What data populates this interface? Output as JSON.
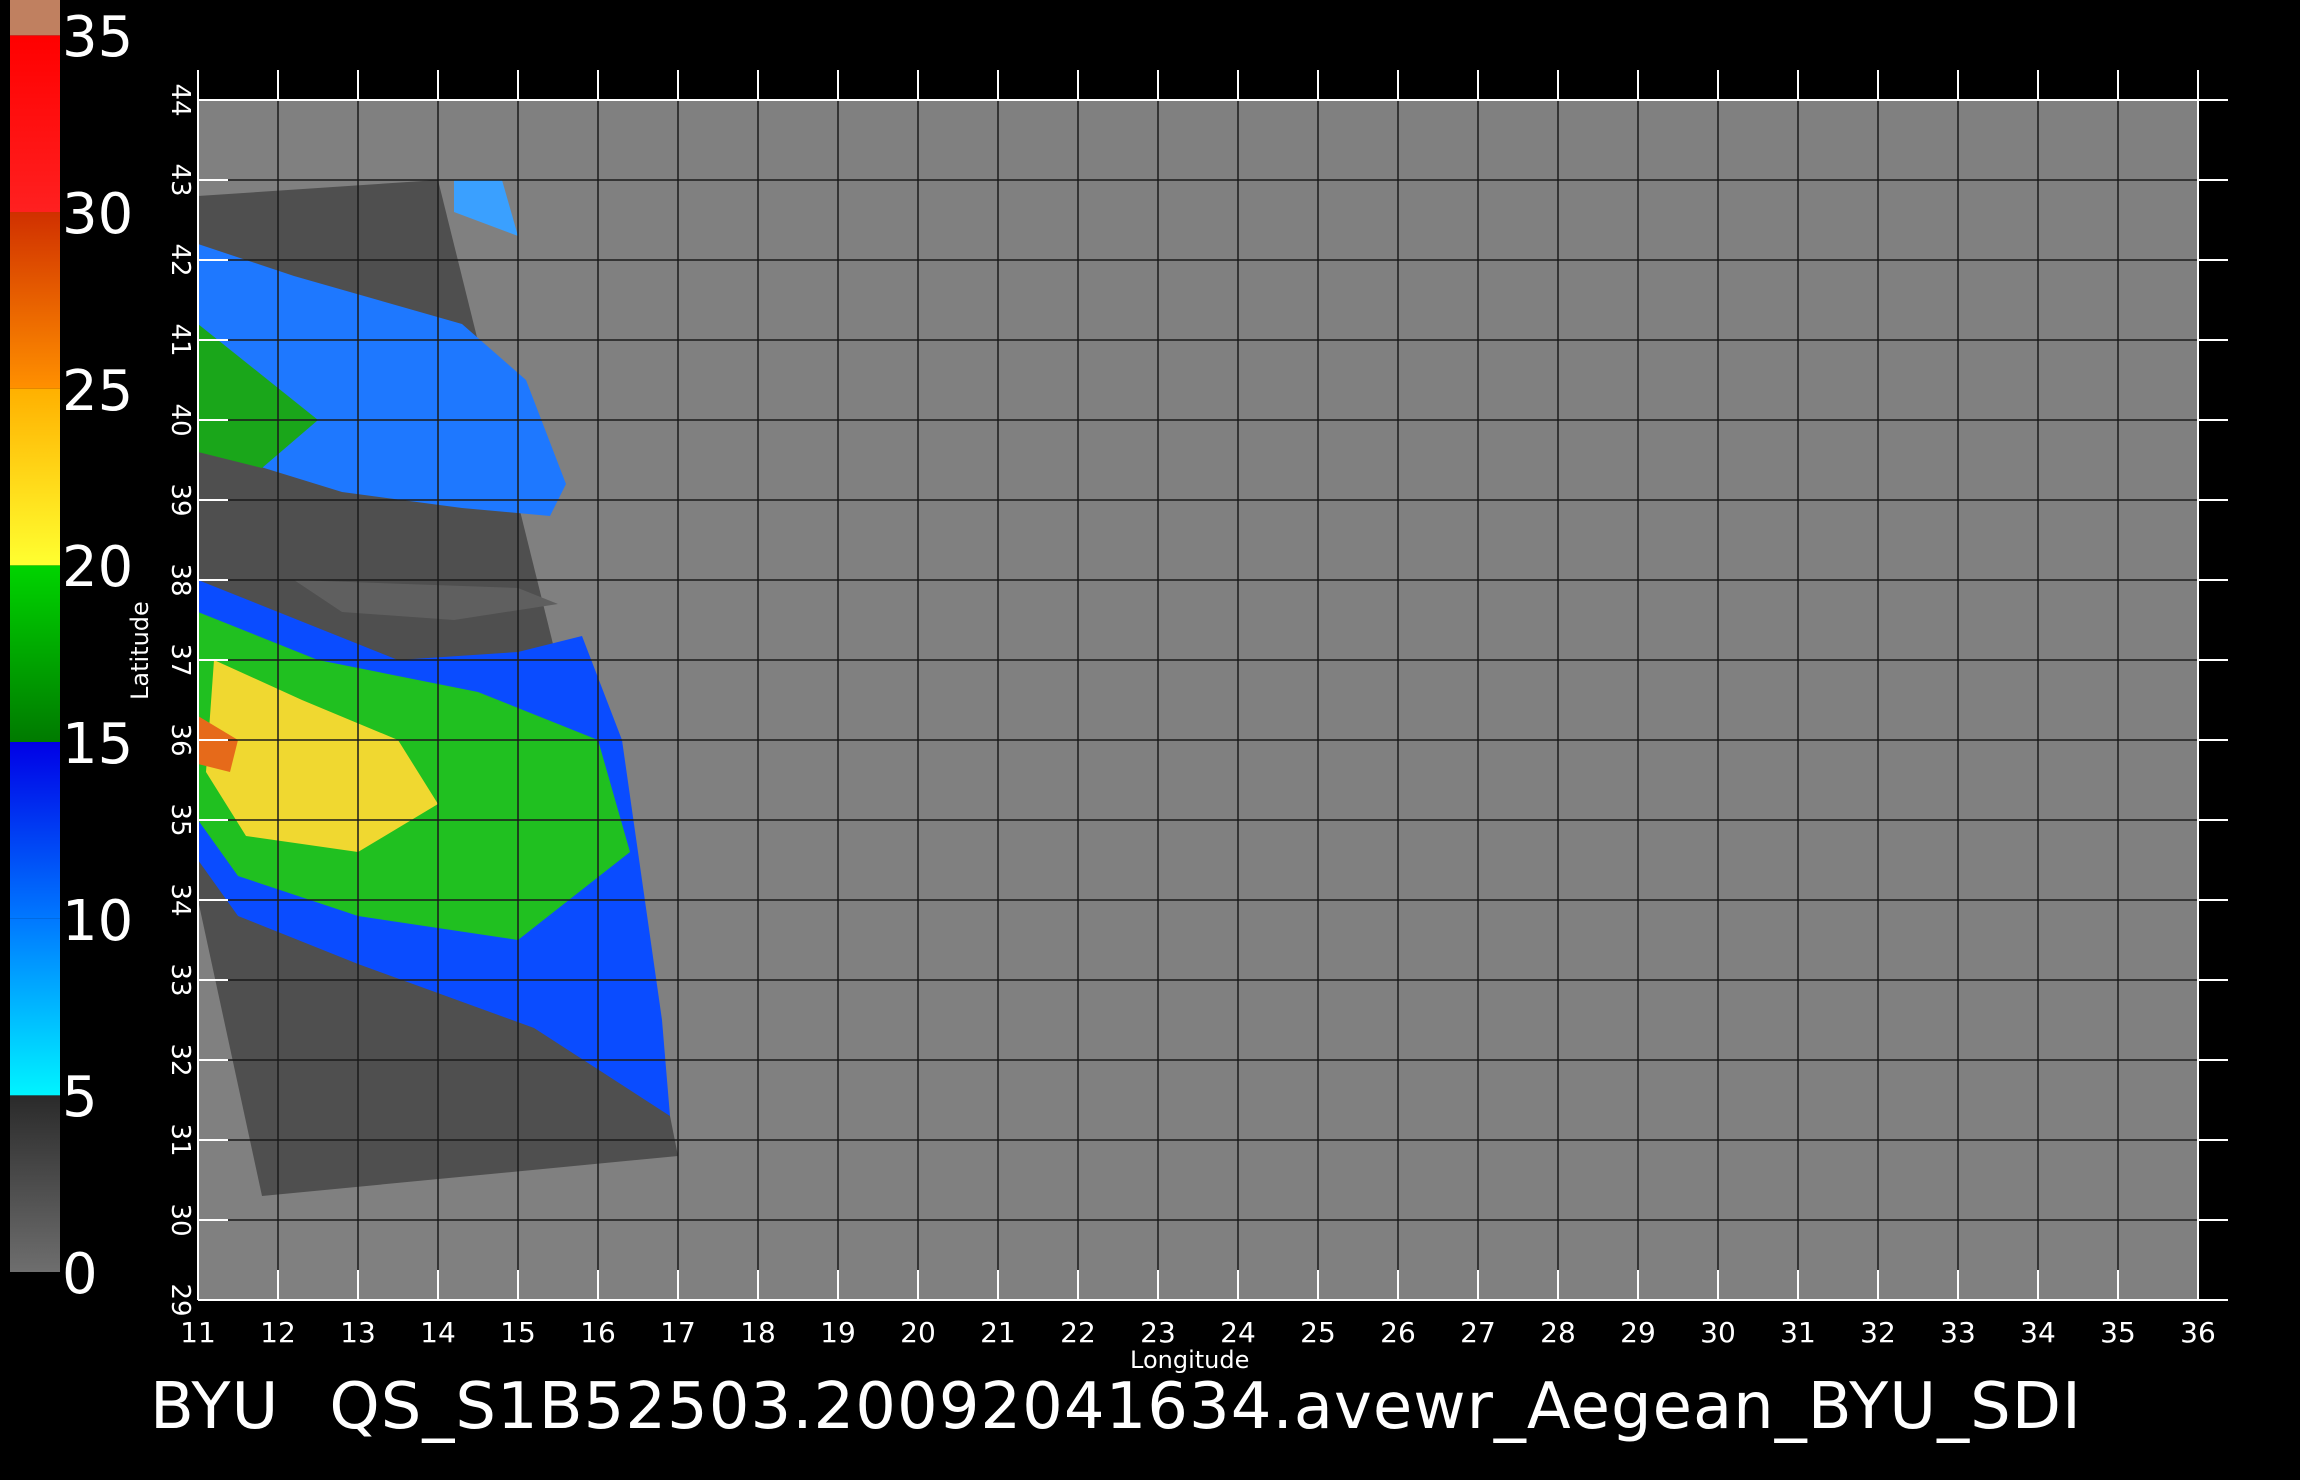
{
  "colorbar": {
    "ticks": [
      "0",
      "5",
      "10",
      "15",
      "20",
      "25",
      "30",
      "35"
    ],
    "bands": [
      {
        "from": 0,
        "to": 5,
        "colors": [
          "#6e6e6e",
          "#2a2a2a"
        ]
      },
      {
        "from": 5,
        "to": 10,
        "colors": [
          "#00f4ff",
          "#0078ff"
        ]
      },
      {
        "from": 10,
        "to": 15,
        "colors": [
          "#0078ff",
          "#0000e6"
        ]
      },
      {
        "from": 15,
        "to": 20,
        "colors": [
          "#007a00",
          "#00d400"
        ]
      },
      {
        "from": 20,
        "to": 25,
        "colors": [
          "#ffff30",
          "#ffb000"
        ]
      },
      {
        "from": 25,
        "to": 30,
        "colors": [
          "#ff9000",
          "#d03000"
        ]
      },
      {
        "from": 30,
        "to": 35,
        "colors": [
          "#ff2020",
          "#ff0000"
        ]
      }
    ],
    "top_cap_color": "#c08060"
  },
  "map": {
    "lon_ticks": [
      "11",
      "12",
      "13",
      "14",
      "15",
      "16",
      "17",
      "18",
      "19",
      "20",
      "21",
      "22",
      "23",
      "24",
      "25",
      "26",
      "27",
      "28",
      "29",
      "30",
      "31",
      "32",
      "33",
      "34",
      "35",
      "36"
    ],
    "lat_ticks": [
      "29",
      "30",
      "31",
      "32",
      "33",
      "34",
      "35",
      "36",
      "37",
      "38",
      "39",
      "40",
      "41",
      "42",
      "43",
      "44"
    ],
    "lon_range": [
      11,
      36
    ],
    "lat_range": [
      29,
      44
    ],
    "xlabel": "Longitude",
    "ylabel": "Latitude",
    "background_color": "#808080",
    "grid_color": "#1a1a1a",
    "swath_color": "#4f4f4f",
    "land_color": "#5a5a5a"
  },
  "footer": {
    "source": "BYU",
    "filename": "QS_S1B52503.20092041634.avewr_Aegean_BYU_SDI"
  }
}
